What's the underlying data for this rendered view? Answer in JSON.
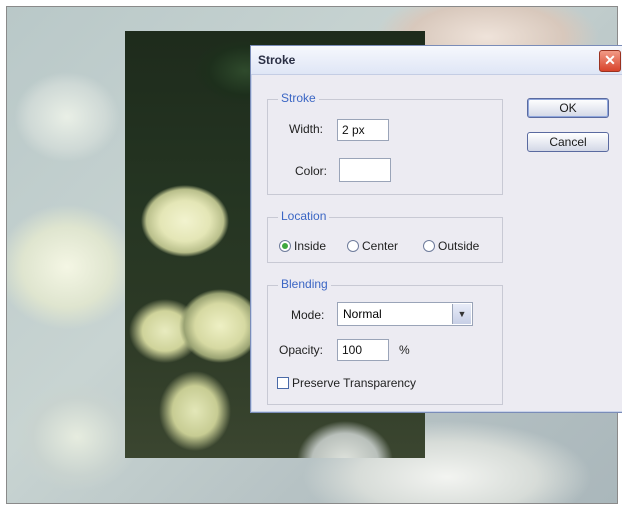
{
  "dialog": {
    "title": "Stroke",
    "close_glyph": "✕",
    "ok_label": "OK",
    "cancel_label": "Cancel",
    "stroke_group": {
      "legend": "Stroke",
      "width_label": "Width:",
      "width_value": "2 px",
      "color_label": "Color:",
      "color_value": "#ffffff"
    },
    "location_group": {
      "legend": "Location",
      "options": [
        "Inside",
        "Center",
        "Outside"
      ],
      "selected": "Inside"
    },
    "blending_group": {
      "legend": "Blending",
      "mode_label": "Mode:",
      "mode_value": "Normal",
      "opacity_label": "Opacity:",
      "opacity_value": "100",
      "opacity_unit": "%",
      "preserve_label": "Preserve Transparency",
      "preserve_checked": false
    }
  },
  "icons": {
    "close": "close-icon",
    "dropdown": "chevron-down-icon"
  }
}
